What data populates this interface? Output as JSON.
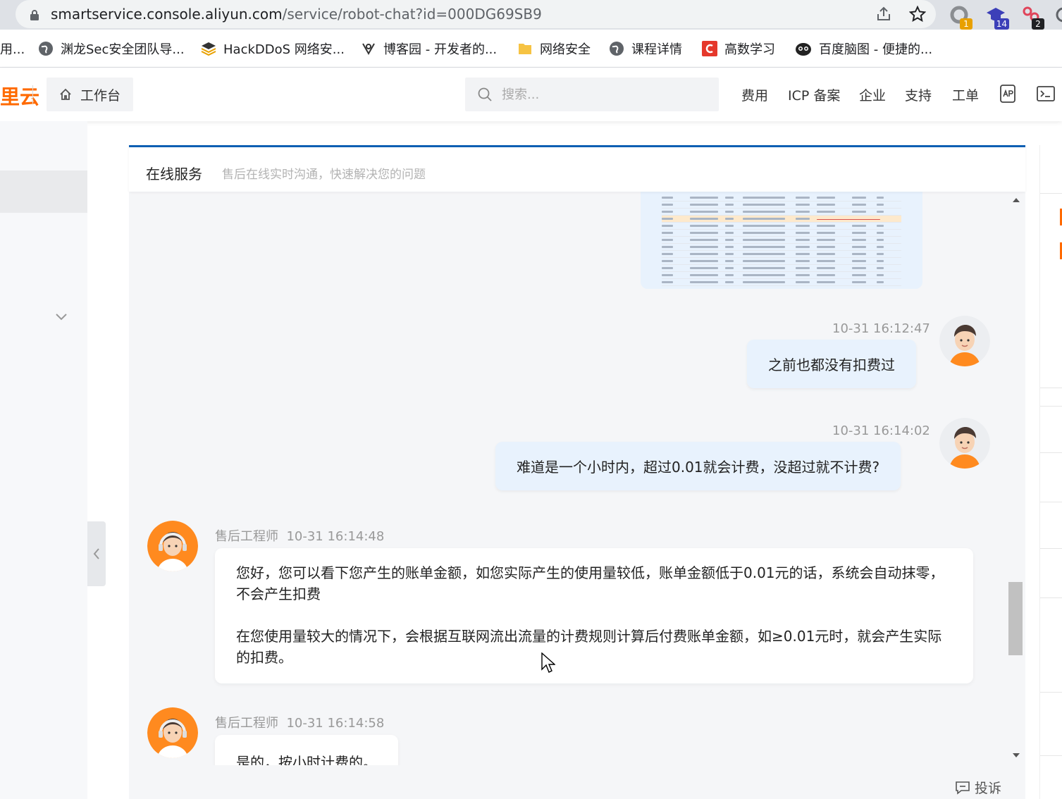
{
  "browser": {
    "url_host": "smartservice.console.aliyun.com",
    "url_path": "/service/robot-chat?id=000DG69SB9",
    "extensions": [
      {
        "name": "ext-1",
        "badge": "1",
        "badge_color": "#e8a000"
      },
      {
        "name": "ext-2",
        "badge": "14",
        "badge_color": "#3c3fb8"
      },
      {
        "name": "ext-3",
        "badge": "2",
        "badge_color": "#202124"
      }
    ],
    "bookmarks": [
      {
        "label": "用...",
        "icon": "none"
      },
      {
        "label": "渊龙Sec安全团队导...",
        "icon": "globe-icon"
      },
      {
        "label": "HackDDoS 网络安...",
        "icon": "layers-icon"
      },
      {
        "label": "博客园 - 开发者的...",
        "icon": "cnblogs-icon"
      },
      {
        "label": "网络安全",
        "icon": "folder-icon"
      },
      {
        "label": "课程详情",
        "icon": "globe-icon"
      },
      {
        "label": "高数学习",
        "icon": "c-icon"
      },
      {
        "label": "百度脑图 - 便捷的...",
        "icon": "baidu-naotu-icon"
      }
    ]
  },
  "header": {
    "logo_fragment": "里云",
    "workbench_label": "工作台",
    "search_placeholder": "搜索...",
    "nav": [
      "费用",
      "ICP 备案",
      "企业",
      "支持",
      "工单"
    ],
    "brand_color": "#ff6a00"
  },
  "chat": {
    "title": "在线服务",
    "subtitle": "售后在线实时沟通，快速解决您的问题",
    "accent_color": "#0d5fb3",
    "messages": [
      {
        "sender": "user",
        "time": "10-31 16:12:47",
        "text": "之前也都没有扣费过"
      },
      {
        "sender": "user",
        "time": "10-31 16:14:02",
        "text": "难道是一个小时内，超过0.01就会计费，没超过就不计费?"
      },
      {
        "sender": "agent",
        "name": "售后工程师",
        "time": "10-31 16:14:48",
        "paragraphs": [
          "您好，您可以看下您产生的账单金额，如您实际产生的使用量较低，账单金额低于0.01元的话，系统会自动抹零，不会产生扣费",
          "在您使用量较大的情况下，会根据互联网流出流量的计费规则计算后付费账单金额，如≥0.01元时，就会产生实际的扣费。"
        ]
      },
      {
        "sender": "agent",
        "name": "售后工程师",
        "time": "10-31 16:14:58",
        "paragraphs": [
          "是的，按小时计费的。"
        ]
      }
    ],
    "complain_label": "投诉"
  }
}
